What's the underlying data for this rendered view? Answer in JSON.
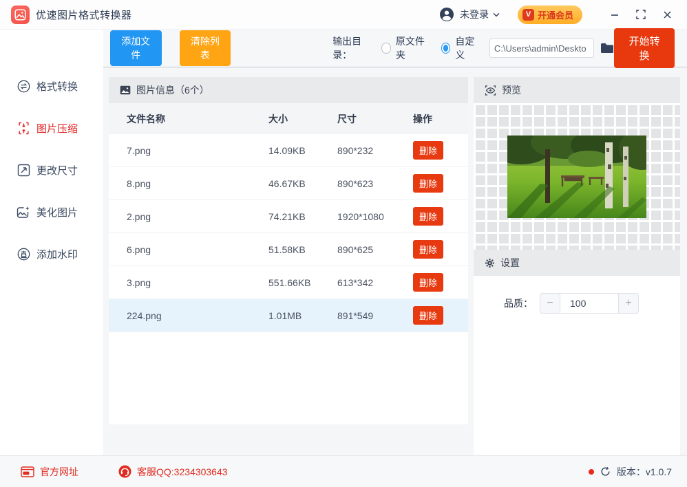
{
  "titlebar": {
    "app_title": "优速图片格式转换器",
    "login_label": "未登录",
    "vip_label": "开通会员",
    "vip_badge_glyph": "V"
  },
  "toolbar": {
    "add_files": "添加文件",
    "clear_list": "清除列表",
    "output_dir_label": "输出目录：",
    "radio_original": "原文件夹",
    "radio_custom": "自定义",
    "radio_selected": "自定义",
    "path_value": "C:\\Users\\admin\\Deskto",
    "start_convert": "开始转换"
  },
  "sidebar": {
    "items": [
      {
        "id": "format-convert",
        "label": "格式转换",
        "icon": "swap-arrows-icon",
        "active": false
      },
      {
        "id": "image-compress",
        "label": "图片压缩",
        "icon": "compress-icon",
        "active": true
      },
      {
        "id": "resize",
        "label": "更改尺寸",
        "icon": "resize-icon",
        "active": false
      },
      {
        "id": "beautify",
        "label": "美化图片",
        "icon": "beautify-icon",
        "active": false
      },
      {
        "id": "watermark",
        "label": "添加水印",
        "icon": "stamp-icon",
        "active": false
      }
    ]
  },
  "table": {
    "title": "图片信息（6个）",
    "columns": [
      "文件名称",
      "大小",
      "尺寸",
      "操作"
    ],
    "delete_label": "删除",
    "selected_index": 5,
    "rows": [
      {
        "name": "7.png",
        "size": "14.09KB",
        "dims": "890*232"
      },
      {
        "name": "8.png",
        "size": "46.67KB",
        "dims": "890*623"
      },
      {
        "name": "2.png",
        "size": "74.21KB",
        "dims": "1920*1080"
      },
      {
        "name": "6.png",
        "size": "51.58KB",
        "dims": "890*625"
      },
      {
        "name": "3.png",
        "size": "551.66KB",
        "dims": "613*342"
      },
      {
        "name": "224.png",
        "size": "1.01MB",
        "dims": "891*549"
      }
    ]
  },
  "preview": {
    "title": "预览"
  },
  "settings": {
    "title": "设置",
    "quality_label": "品质：",
    "quality_value": "100",
    "minus_glyph": "−",
    "plus_glyph": "+"
  },
  "footer": {
    "website": "官方网址",
    "qq": "客服QQ:3234303643",
    "version": "版本：v1.0.7"
  },
  "colors": {
    "accent_blue": "#2196f3",
    "accent_orange": "#ffa413",
    "accent_red": "#e8380e",
    "active_menu_red": "#e02020",
    "footer_red": "#e02b20",
    "selected_row": "#e7f3fc",
    "vip_gold": "#ffb640",
    "band_gray": "#e9eaec"
  }
}
